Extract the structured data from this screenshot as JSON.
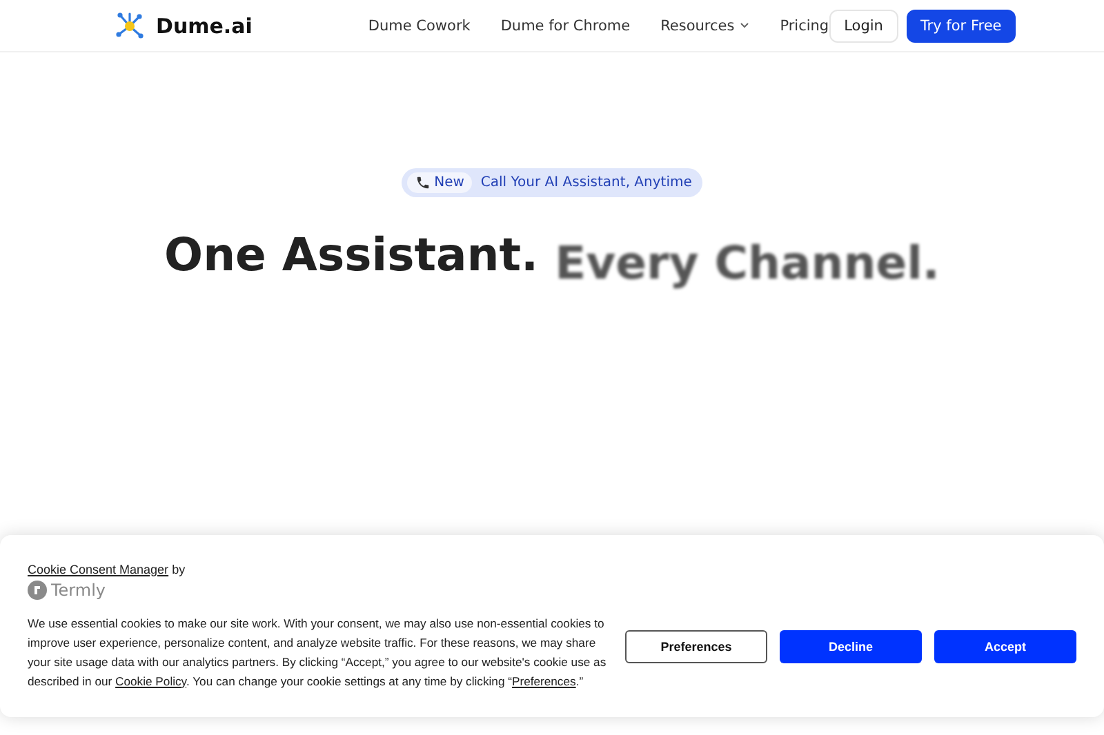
{
  "nav": {
    "brand": "Dume.ai",
    "links": [
      {
        "label": "Dume Cowork",
        "dropdown": false
      },
      {
        "label": "Dume for Chrome",
        "dropdown": false
      },
      {
        "label": "Resources",
        "dropdown": true
      },
      {
        "label": "Pricing",
        "dropdown": false
      }
    ],
    "login": "Login",
    "cta": "Try for Free"
  },
  "hero": {
    "badge": {
      "tag": "New",
      "text": "Call Your AI Assistant, Anytime"
    },
    "headline": [
      {
        "text": "One Assistant.",
        "faded": false
      },
      {
        "text": "Every Channel.",
        "faded": true
      }
    ]
  },
  "cookie_banner": {
    "manager_link": "Cookie Consent Manager",
    "by": "by",
    "provider": "Termly",
    "body": [
      {
        "kind": "text",
        "text": "We use essential cookies to make our site work. With your consent, we may also use non-essential cookies to improve user experience, personalize content, and analyze website traffic. For these reasons, we may share your site usage data with our analytics partners. By clicking “Accept,” you agree to our website's cookie use as described in our "
      },
      {
        "kind": "link",
        "text": "Cookie Policy"
      },
      {
        "kind": "text",
        "text": ". You can change your cookie settings at any time by clicking “"
      },
      {
        "kind": "link",
        "text": "Preferences"
      },
      {
        "kind": "text",
        "text": ".”"
      }
    ],
    "buttons": [
      {
        "label": "Preferences",
        "kind": "outline"
      },
      {
        "label": "Decline",
        "kind": "primary"
      },
      {
        "label": "Accept",
        "kind": "primary"
      }
    ]
  }
}
